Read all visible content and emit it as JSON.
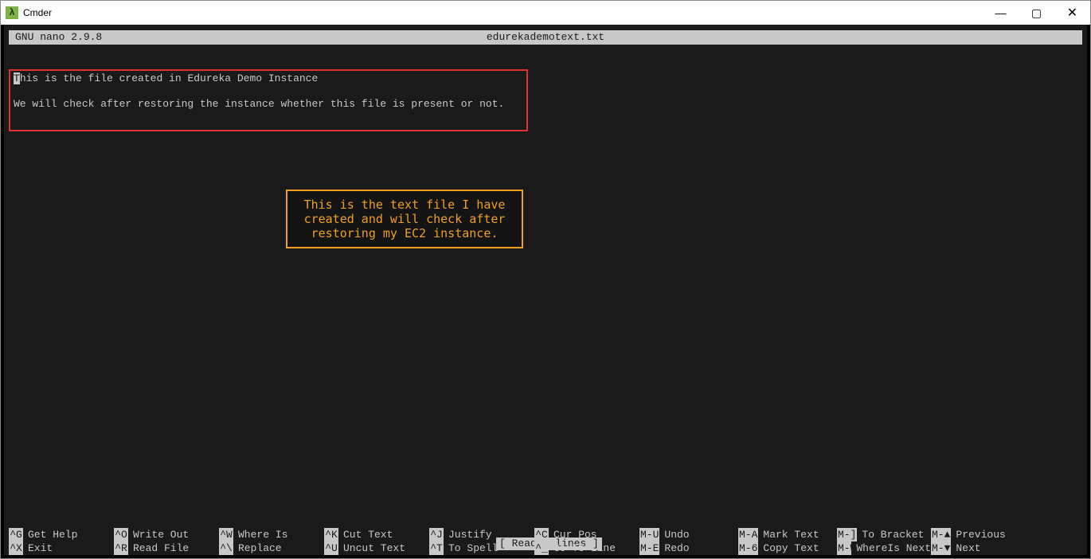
{
  "window": {
    "title": "Cmder",
    "app_icon_letter": "λ"
  },
  "nano": {
    "version": "  GNU nano 2.9.8",
    "filename": "edurekademotext.txt",
    "status": "[ Read 4 lines ]",
    "content_line1_first": "T",
    "content_line1_rest": "his is the file created in Edureka Demo Instance",
    "content_line2": "",
    "content_line3": "We will check after restoring the instance whether this file is present or not."
  },
  "annotation": {
    "text": "This is the text file I have created and will check after restoring my EC2 instance."
  },
  "footer": {
    "row1": [
      {
        "key": "^G",
        "label": "Get Help"
      },
      {
        "key": "^O",
        "label": "Write Out"
      },
      {
        "key": "^W",
        "label": "Where Is"
      },
      {
        "key": "^K",
        "label": "Cut Text"
      },
      {
        "key": "^J",
        "label": "Justify"
      },
      {
        "key": "^C",
        "label": "Cur Pos"
      },
      {
        "key": "M-U",
        "label": "Undo"
      },
      {
        "key": "M-A",
        "label": "Mark Text"
      },
      {
        "key": "M-]",
        "label": "To Bracket"
      },
      {
        "key": "M-▲",
        "label": "Previous"
      }
    ],
    "row2": [
      {
        "key": "^X",
        "label": "Exit"
      },
      {
        "key": "^R",
        "label": "Read File"
      },
      {
        "key": "^\\",
        "label": "Replace"
      },
      {
        "key": "^U",
        "label": "Uncut Text"
      },
      {
        "key": "^T",
        "label": "To Spell"
      },
      {
        "key": "^_",
        "label": "Go To Line"
      },
      {
        "key": "M-E",
        "label": "Redo"
      },
      {
        "key": "M-6",
        "label": "Copy Text"
      },
      {
        "key": "M-W",
        "label": "WhereIs Next"
      },
      {
        "key": "M-▼",
        "label": "Next"
      }
    ]
  }
}
